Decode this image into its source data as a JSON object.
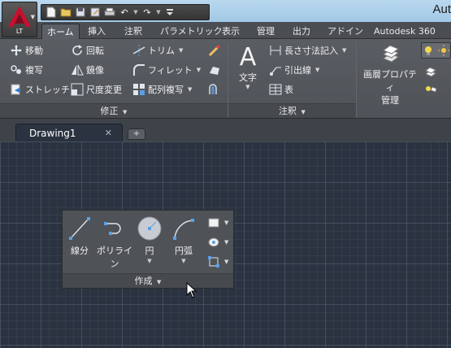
{
  "window": {
    "title": "Aut"
  },
  "app_button": {
    "label": "LT"
  },
  "quick_access": {
    "icons": [
      "new-icon",
      "open-icon",
      "save-icon",
      "saveas-icon",
      "plot-icon",
      "undo-icon",
      "redo-icon",
      "customize-icon"
    ]
  },
  "ribbon_tabs": [
    "ホーム",
    "挿入",
    "注釈",
    "パラメトリック",
    "表示",
    "管理",
    "出力",
    "アドイン",
    "Autodesk 360"
  ],
  "modify_panel": {
    "title": "修正",
    "rows": [
      [
        "移動",
        "回転",
        "トリム"
      ],
      [
        "複写",
        "鏡像",
        "フィレット"
      ],
      [
        "ストレッチ",
        "尺度変更",
        "配列複写"
      ]
    ]
  },
  "annotation_panel": {
    "title": "注釈",
    "big_label": "文字",
    "buttons": [
      "長さ寸法記入",
      "引出線",
      "表"
    ]
  },
  "layers_panel": {
    "big_label_line1": "画層プロパティ",
    "big_label_line2": "管理"
  },
  "document_tabs": [
    {
      "label": "Drawing1",
      "active": true
    }
  ],
  "draw_panel": {
    "title": "作成",
    "buttons": [
      "線分",
      "ポリライン",
      "円",
      "円弧"
    ]
  },
  "colors": {
    "canvas": "#2b3340",
    "ribbon": "#53575c",
    "accent": "#c8102e"
  }
}
